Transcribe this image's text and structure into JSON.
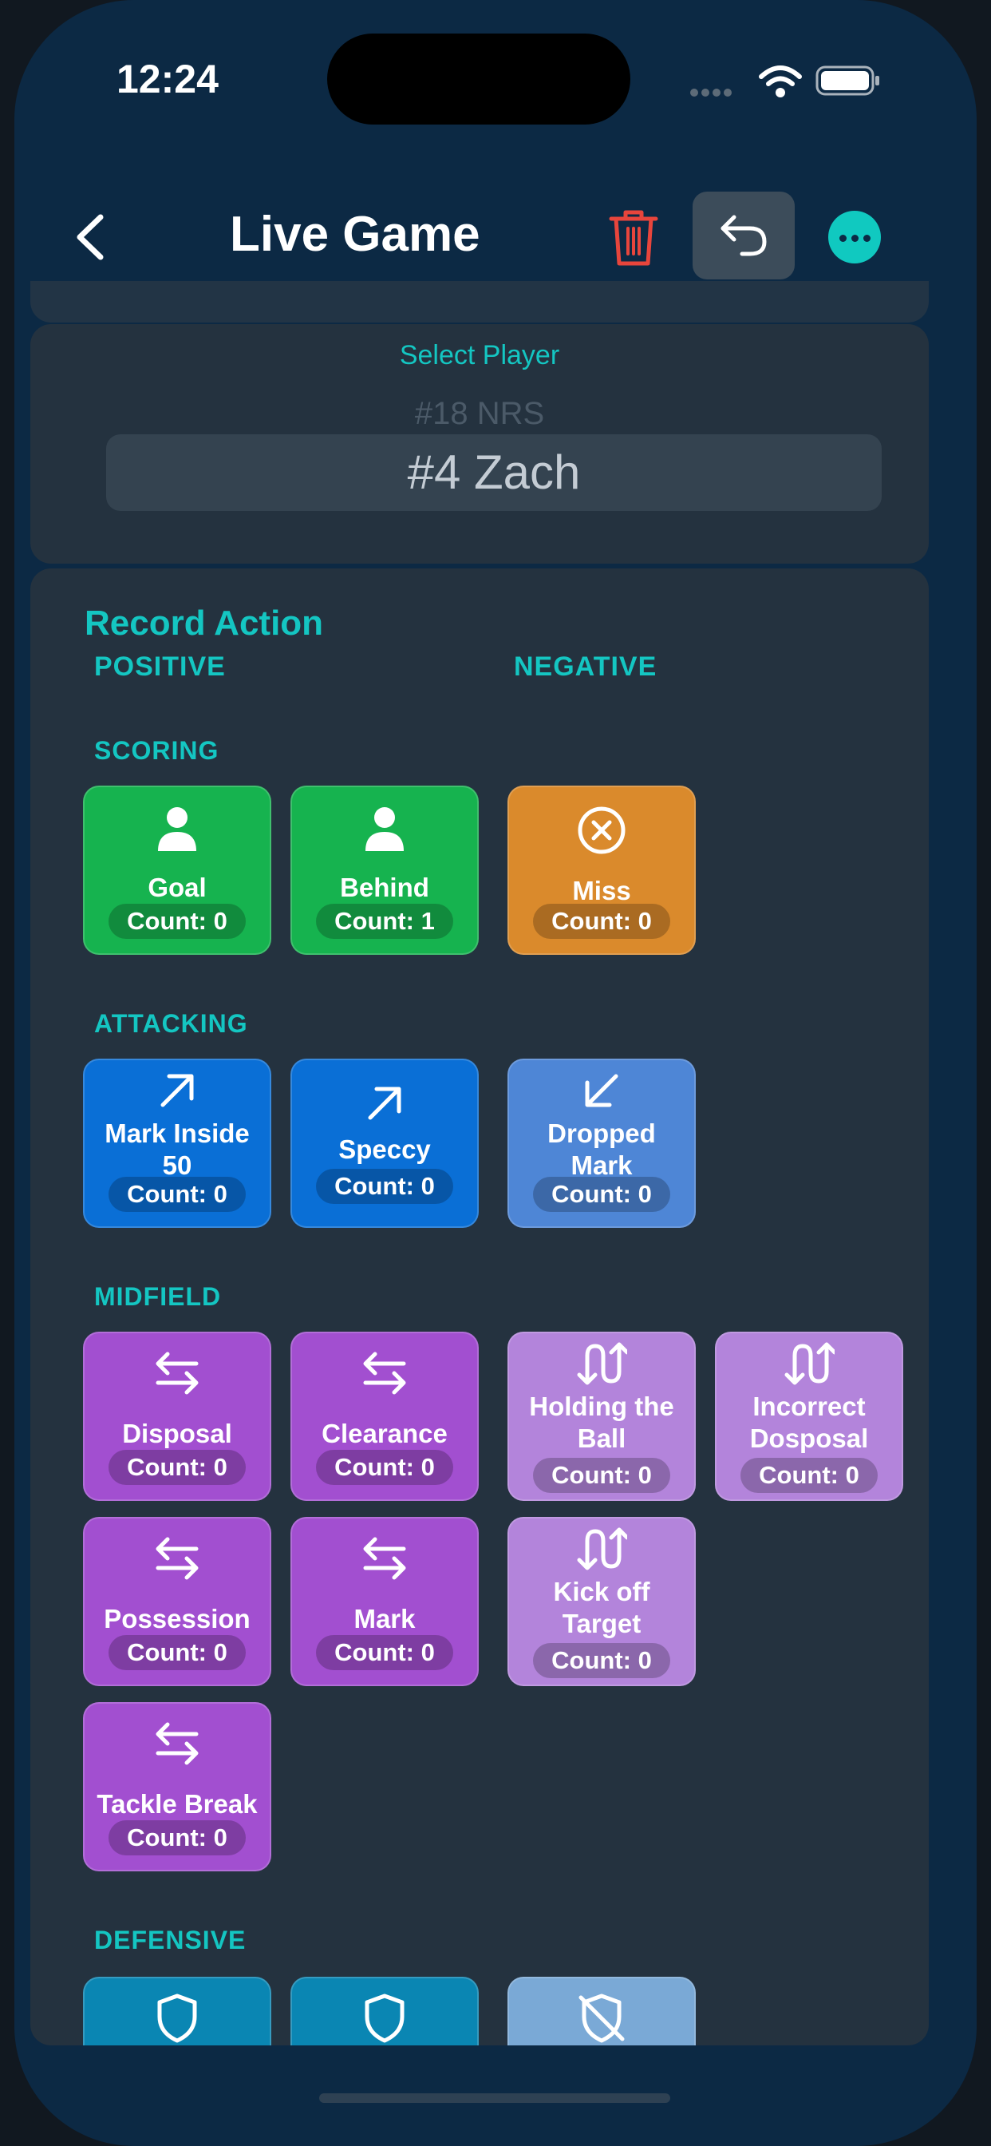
{
  "status_bar": {
    "time": "12:24"
  },
  "nav": {
    "title": "Live Game"
  },
  "player_select": {
    "label": "Select Player",
    "previous_option": "#18 NRS",
    "selected": "#4 Zach"
  },
  "record": {
    "title": "Record Action",
    "positive_label": "POSITIVE",
    "negative_label": "NEGATIVE"
  },
  "sections": {
    "scoring": "SCORING",
    "attacking": "ATTACKING",
    "midfield": "MIDFIELD",
    "defensive": "DEFENSIVE"
  },
  "actions": {
    "goal": {
      "label": "Goal",
      "count": "Count: 0"
    },
    "behind": {
      "label": "Behind",
      "count": "Count: 1"
    },
    "miss": {
      "label": "Miss",
      "count": "Count: 0"
    },
    "mark_inside_50": {
      "label": "Mark Inside 50",
      "count": "Count: 0"
    },
    "speccy": {
      "label": "Speccy",
      "count": "Count: 0"
    },
    "dropped_mark": {
      "label": "Dropped Mark",
      "count": "Count: 0"
    },
    "disposal": {
      "label": "Disposal",
      "count": "Count: 0"
    },
    "clearance": {
      "label": "Clearance",
      "count": "Count: 0"
    },
    "holding_the_ball": {
      "label": "Holding the Ball",
      "count": "Count: 0"
    },
    "incorrect_dosposal": {
      "label": "Incorrect Dosposal",
      "count": "Count: 0"
    },
    "possession": {
      "label": "Possession",
      "count": "Count: 0"
    },
    "mark": {
      "label": "Mark",
      "count": "Count: 0"
    },
    "kick_off_target": {
      "label": "Kick off Target",
      "count": "Count: 0"
    },
    "tackle_break": {
      "label": "Tackle Break",
      "count": "Count: 0"
    }
  },
  "colors": {
    "accent": "#14c6c2",
    "scoring_positive": "#16b34f",
    "scoring_negative": "#da8a2c",
    "attacking_positive": "#0a6fd6",
    "attacking_negative": "#4e86d6",
    "midfield_positive": "#a24fd0",
    "midfield_negative": "#b384db",
    "defensive_positive": "#0a86b3",
    "defensive_negative": "#7aa9d6",
    "delete": "#e8453c"
  }
}
